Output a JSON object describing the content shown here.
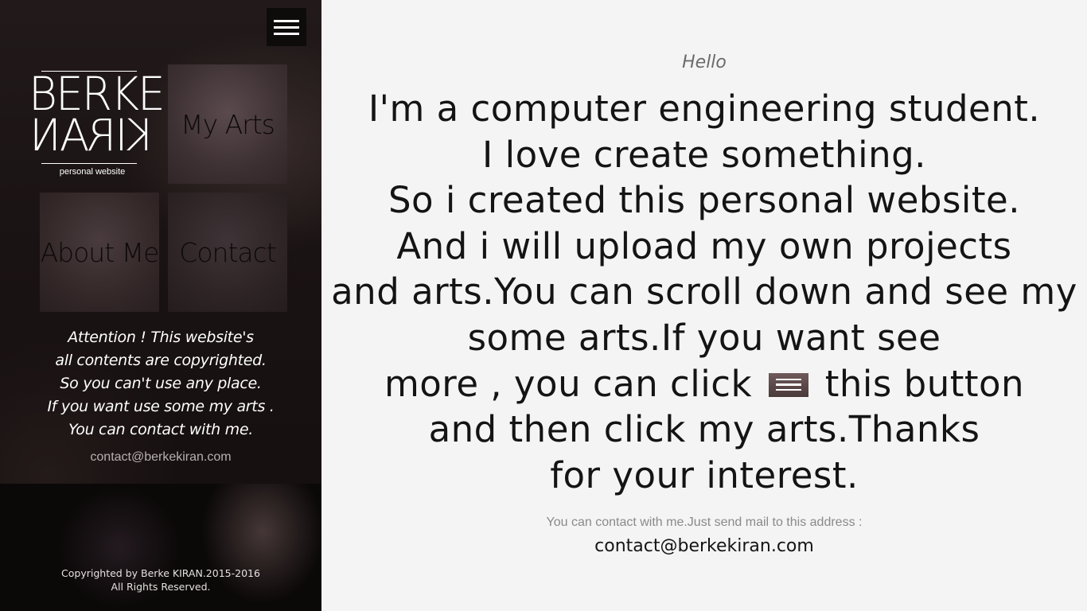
{
  "sidebar": {
    "menu_icon": "hamburger-menu-icon",
    "logo": {
      "line1": "BERKE",
      "line2": "KIRAN",
      "tagline": "personal website"
    },
    "tiles": {
      "arts": "My Arts",
      "about": "About Me",
      "contact": "Contact"
    },
    "notice": [
      "Attention ! This website's",
      "all contents are copyrighted.",
      "So you can't use any place.",
      "If you want use some my arts .",
      "You can contact with me."
    ],
    "email": "contact@berkekiran.com",
    "footer": {
      "line1": "Copyrighted by Berke KIRAN.2015-2016",
      "line2": "All Rights Reserved."
    }
  },
  "main": {
    "greeting": "Hello",
    "lines": [
      "I'm a computer engineering student.",
      "I love create something.",
      "So i created this personal website.",
      "And i will upload my own projects",
      "and arts.You can scroll down and see my",
      "some arts.If you want see"
    ],
    "line_with_button": {
      "before": "more , you can click",
      "after": "this button"
    },
    "lines_after": [
      "and then click my arts.Thanks",
      "for your interest."
    ],
    "contact_note": "You can contact with me.Just send mail to this address :",
    "email": "contact@berkekiran.com"
  },
  "colors": {
    "sidebar_bg": "#1a1313",
    "main_bg": "#f4f4f4",
    "text_dark": "#141414",
    "menu_button_bg": "#0e0b0b"
  }
}
